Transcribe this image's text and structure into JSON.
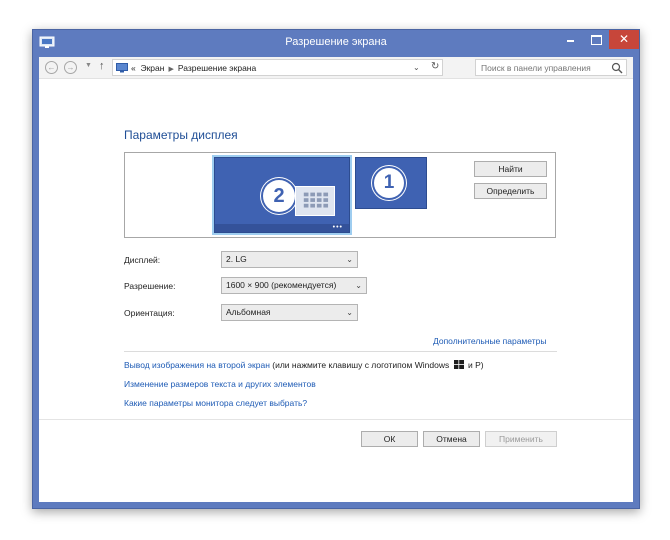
{
  "window": {
    "title": "Разрешение экрана"
  },
  "controls": {
    "close": "✕"
  },
  "nav": {
    "breadcrumb_prefix": "«",
    "breadcrumb": [
      "Экран",
      "Разрешение экрана"
    ],
    "search_placeholder": "Поиск в панели управления"
  },
  "main": {
    "heading": "Параметры дисплея",
    "monitors": [
      {
        "number": "2",
        "selected": true
      },
      {
        "number": "1",
        "selected": false
      }
    ],
    "find_button": "Найти",
    "identify_button": "Определить",
    "display_label": "Дисплей:",
    "display_value": "2. LG",
    "resolution_label": "Разрешение:",
    "resolution_value": "1600 × 900 (рекомендуется)",
    "orientation_label": "Ориентация:",
    "orientation_value": "Альбомная",
    "advanced_link": "Дополнительные параметры",
    "second_screen_link": "Вывод изображения на второй экран",
    "second_screen_hint_pre": "(или нажмите клавишу с логотипом Windows",
    "second_screen_hint_post": "и P)",
    "text_size_link": "Изменение размеров текста и других элементов",
    "which_settings_link": "Какие параметры монитора следует выбрать?"
  },
  "footer": {
    "ok": "ОК",
    "cancel": "Отмена",
    "apply": "Применить"
  },
  "colors": {
    "title_bar": "#5e7bbf",
    "close_button": "#c7463a",
    "link": "#1e5bb5",
    "monitor": "#3f62b2"
  }
}
